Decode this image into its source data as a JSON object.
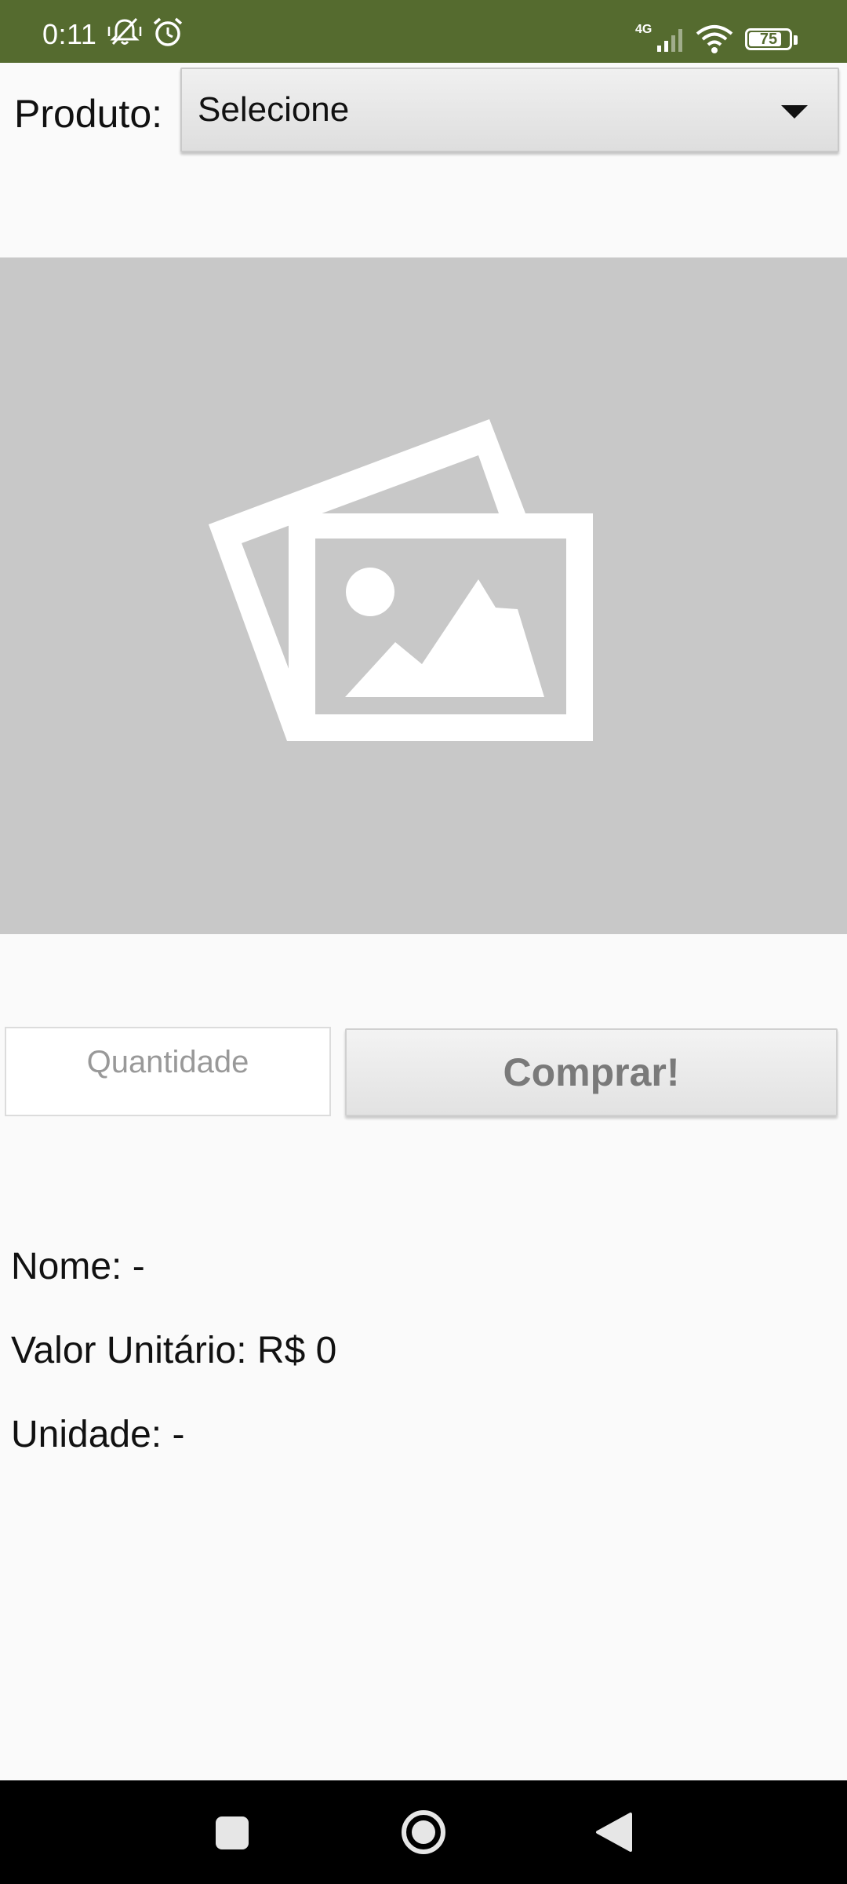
{
  "status_bar": {
    "time": "0:11",
    "network": "4G",
    "battery": "75",
    "background_color": "#556b2f",
    "icons": [
      "vibrate-muted-icon",
      "alarm-icon",
      "signal-icon",
      "wifi-icon",
      "battery-icon"
    ]
  },
  "form": {
    "product_label": "Produto:",
    "product_select_value": "Selecione",
    "quantity_placeholder": "Quantidade",
    "buy_button_label": "Comprar!"
  },
  "image": {
    "icon": "image-placeholder-icon"
  },
  "details": {
    "name": "Nome: -",
    "unit_price": "Valor Unitário: R$ 0",
    "unit": "Unidade: -"
  },
  "nav_bar": {
    "buttons": [
      "recents-square-icon",
      "home-circle-icon",
      "back-triangle-icon"
    ]
  }
}
